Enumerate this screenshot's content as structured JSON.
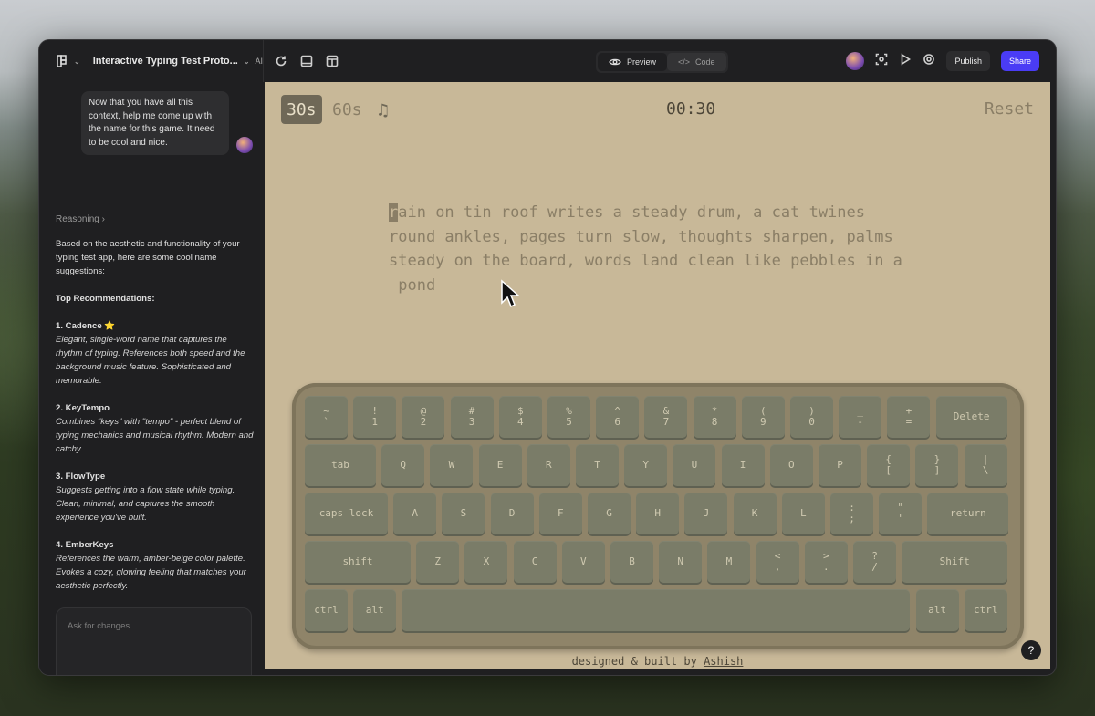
{
  "project": {
    "title": "Interactive Typing Test Proto...",
    "ai_label": "AI"
  },
  "view_toggle": {
    "preview": "Preview",
    "code": "Code"
  },
  "header": {
    "publish": "Publish",
    "share": "Share"
  },
  "chat": {
    "user_message": "Now that you have all this context, help me come up with the name for this game. It need to be cool and nice.",
    "reasoning": "Reasoning",
    "intro": "Based on the aesthetic and functionality of your typing test app, here are some cool name suggestions:",
    "top_heading": "Top Recommendations:",
    "suggestions": [
      {
        "title": "1. Cadence ⭐",
        "desc": "Elegant, single-word name that captures the rhythm of typing. References both speed and the background music feature. Sophisticated and memorable."
      },
      {
        "title": "2. KeyTempo",
        "desc": "Combines \"keys\" with \"tempo\" - perfect blend of typing mechanics and musical rhythm. Modern and catchy."
      },
      {
        "title": "3. FlowType",
        "desc": "Suggests getting into a flow state while typing. Clean, minimal, and captures the smooth experience you've built."
      },
      {
        "title": "4. EmberKeys",
        "desc": "References the warm, amber-beige color palette. Evokes a cozy, glowing feeling that matches your aesthetic perfectly."
      }
    ],
    "input_placeholder": "Ask for changes"
  },
  "app": {
    "mode_30": "30s",
    "mode_60": "60s",
    "timer": "00:30",
    "reset": "Reset",
    "text_first_char": "r",
    "text_rest": "ain on tin roof writes a steady drum, a cat twines",
    "text_line2": "round ankles, pages turn slow, thoughts sharpen, palms",
    "text_line3": "steady on the board, words land clean like pebbles in a",
    "text_line4": " pond",
    "footer_prefix": "designed & built by ",
    "footer_author": "Ashish",
    "help": "?"
  },
  "keyboard": {
    "rows": [
      [
        [
          "~",
          "`"
        ],
        [
          "!",
          "1"
        ],
        [
          "@",
          "2"
        ],
        [
          "#",
          "3"
        ],
        [
          "$",
          "4"
        ],
        [
          "%",
          "5"
        ],
        [
          "^",
          "6"
        ],
        [
          "&",
          "7"
        ],
        [
          "*",
          "8"
        ],
        [
          "(",
          "9"
        ],
        [
          ")",
          "0"
        ],
        [
          "_",
          "-"
        ],
        [
          "+",
          "="
        ],
        [
          "Delete"
        ]
      ],
      [
        [
          "tab"
        ],
        [
          "Q"
        ],
        [
          "W"
        ],
        [
          "E"
        ],
        [
          "R"
        ],
        [
          "T"
        ],
        [
          "Y"
        ],
        [
          "U"
        ],
        [
          "I"
        ],
        [
          "O"
        ],
        [
          "P"
        ],
        [
          "{",
          "["
        ],
        [
          "}",
          "]"
        ],
        [
          "|",
          "\\"
        ]
      ],
      [
        [
          "caps lock"
        ],
        [
          "A"
        ],
        [
          "S"
        ],
        [
          "D"
        ],
        [
          "F"
        ],
        [
          "G"
        ],
        [
          "H"
        ],
        [
          "J"
        ],
        [
          "K"
        ],
        [
          "L"
        ],
        [
          ":",
          ";"
        ],
        [
          "\"",
          "'"
        ],
        [
          "return"
        ]
      ],
      [
        [
          "shift"
        ],
        [
          "Z"
        ],
        [
          "X"
        ],
        [
          "C"
        ],
        [
          "V"
        ],
        [
          "B"
        ],
        [
          "N"
        ],
        [
          "M"
        ],
        [
          "<",
          ","
        ],
        [
          ">",
          "."
        ],
        [
          "?",
          "/"
        ],
        [
          "Shift"
        ]
      ],
      [
        [
          "ctrl"
        ],
        [
          "alt"
        ],
        [
          ""
        ],
        [
          "alt"
        ],
        [
          "ctrl"
        ]
      ]
    ]
  }
}
